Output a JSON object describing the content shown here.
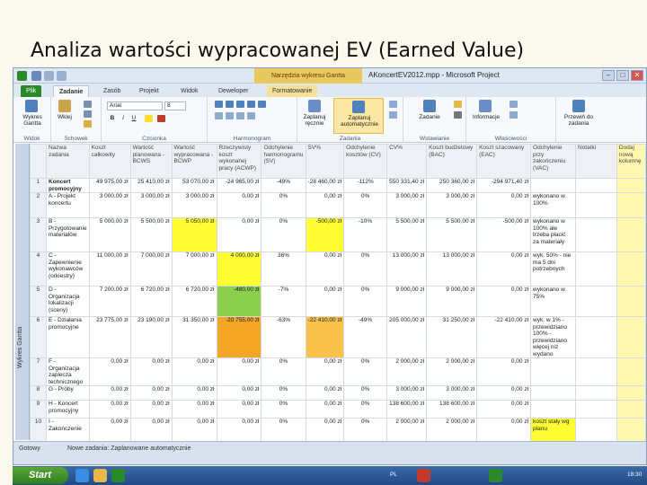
{
  "slide_title": "Analiza wartości wypracowanej EV (Earned Value)",
  "window": {
    "context_tab": "Narzędzia wykresu Gantta",
    "doc_title": "AKoncertEV2012.mpp - Microsoft Project",
    "min": "–",
    "max": "□",
    "close": "✕"
  },
  "tabs": {
    "file": "Plik",
    "task": "Zadanie",
    "resource": "Zasób",
    "project": "Projekt",
    "view": "Widok",
    "developer": "Deweloper",
    "format": "Formatowanie"
  },
  "ribbon": {
    "gantt_chart": "Wykres Gantta",
    "paste": "Wklej",
    "font_name": "Arial",
    "font_size": "8",
    "bold": "B",
    "italic": "I",
    "underline": "U",
    "manual": "Zaplanuj ręcznie",
    "auto": "Zaplanuj automatycznie",
    "task": "Zadanie",
    "info": "Informacje",
    "scroll": "Przewiń do zadania",
    "groups": {
      "view": "Widok",
      "clipboard": "Schowek",
      "font": "Czcionka",
      "schedule": "Harmonogram",
      "tasks": "Zadania",
      "insert": "Wstawianie",
      "properties": "Właściwości"
    }
  },
  "columns": [
    "Nazwa zadania",
    "Koszt całkowity",
    "Wartość planowana - BCWS",
    "Wartość wypracowana - BCWP",
    "Rzeczywisty koszt wykonanej pracy (ACWP)",
    "Odchylenie harmonogramu (SV)",
    "SV%",
    "Odchylenie kosztów (CV)",
    "CV%",
    "Koszt budżetowy (BAC)",
    "Koszt szacowany (EAC)",
    "Odchylenie przy zakończeniu (VAC)",
    "Notatki",
    "Dodaj nową kolumnę"
  ],
  "rows": [
    {
      "id": "1",
      "name": "Koncert promocyjny",
      "cost": "49 975,00 zł",
      "bcws": "25 410,00 zł",
      "bcwp": "53 070,00 zł",
      "acwp": "-24 965,00 zł",
      "sv": "-49%",
      "svp": "-28 460,00 zł",
      "cv": "-112%",
      "cvp": "550 331,40 zł",
      "bac": "250 360,00 zł",
      "eac": "-294 971,40 zł",
      "notes": ""
    },
    {
      "id": "2",
      "name": "A - Projekt koncertu",
      "cost": "3 000,00 zł",
      "bcws": "3 000,00 zł",
      "bcwp": "3 000,00 zł",
      "acwp": "0,00 zł",
      "sv": "0%",
      "svp": "0,00 zł",
      "cv": "0%",
      "cvp": "3 000,00 zł",
      "bac": "3 000,00 zł",
      "eac": "0,00 zł",
      "notes": "wykonano w 100%"
    },
    {
      "id": "3",
      "name": "B - Przygotowanie materiałów",
      "cost": "5 000,00 zł",
      "bcws": "5 500,00 zł",
      "bcwp": "5 050,00 zł",
      "acwp": "0,00 zł",
      "sv": "0%",
      "svp": "-500,00 zł",
      "cv": "-10%",
      "cvp": "5 500,00 zł",
      "bac": "5 500,00 zł",
      "eac": "-500,00 zł",
      "notes": "wykonano w 100% ale trzeba płacić za materiały"
    },
    {
      "id": "4",
      "name": "C - Zapewnienie wykonawców (orkiestry)",
      "cost": "11 000,00 zł",
      "bcws": "7 000,00 zł",
      "bcwp": "7 000,00 zł",
      "acwp": "4 000,00 zł",
      "sv": "36%",
      "svp": "0,00 zł",
      "cv": "0%",
      "cvp": "13 000,00 zł",
      "bac": "13 000,00 zł",
      "eac": "0,00 zł",
      "notes": "wyk. 50% - nie ma 5 dni potrzebnych"
    },
    {
      "id": "5",
      "name": "D - Organizacja lokalizacji (sceny)",
      "cost": "7 200,00 zł",
      "bcws": "6 720,00 zł",
      "bcwp": "6 720,00 zł",
      "acwp": "-480,00 zł",
      "sv": "-7%",
      "svp": "0,00 zł",
      "cv": "0%",
      "cvp": "9 000,00 zł",
      "bac": "9 000,00 zł",
      "eac": "0,00 zł",
      "notes": "wykonano w 75%"
    },
    {
      "id": "6",
      "name": "E - Działania promocyjne",
      "cost": "23 775,00 zł",
      "bcws": "23 190,00 zł",
      "bcwp": "31 350,00 zł",
      "acwp": "-20 755,00 zł",
      "sv": "-63%",
      "svp": "-22 410,00 zł",
      "cv": "-49%",
      "cvp": "205 000,00 zł",
      "bac": "31 250,00 zł",
      "eac": "-22 410,00 zł",
      "notes": "wyk. w 1% - przewidziano 100% - przewidziano więcej niż wydano"
    },
    {
      "id": "7",
      "name": "F - Organizacja zaplecza technicznego",
      "cost": "0,00 zł",
      "bcws": "0,00 zł",
      "bcwp": "0,00 zł",
      "acwp": "0,00 zł",
      "sv": "0%",
      "svp": "0,00 zł",
      "cv": "0%",
      "cvp": "2 000,00 zł",
      "bac": "2 000,00 zł",
      "eac": "0,00 zł",
      "notes": ""
    },
    {
      "id": "8",
      "name": "G - Próby",
      "cost": "0,00 zł",
      "bcws": "0,00 zł",
      "bcwp": "0,00 zł",
      "acwp": "0,00 zł",
      "sv": "0%",
      "svp": "0,00 zł",
      "cv": "0%",
      "cvp": "3 000,00 zł",
      "bac": "3 000,00 zł",
      "eac": "0,00 zł",
      "notes": ""
    },
    {
      "id": "9",
      "name": "H - Koncert promocyjny",
      "cost": "0,00 zł",
      "bcws": "0,00 zł",
      "bcwp": "0,00 zł",
      "acwp": "0,00 zł",
      "sv": "0%",
      "svp": "0,00 zł",
      "cv": "0%",
      "cvp": "138 600,00 zł",
      "bac": "138 600,00 zł",
      "eac": "0,00 zł",
      "notes": ""
    },
    {
      "id": "10",
      "name": "I - Zakończenie",
      "cost": "0,00 zł",
      "bcws": "0,00 zł",
      "bcwp": "0,00 zł",
      "acwp": "0,00 zł",
      "sv": "0%",
      "svp": "0,00 zł",
      "cv": "0%",
      "cvp": "2 000,00 zł",
      "bac": "2 000,00 zł",
      "eac": "0,00 zł",
      "notes": "koszt stały wg planu"
    }
  ],
  "statusbar": {
    "ready": "Gotowy",
    "new_tasks": "Nowe zadania: Zaplanowane automatycznie"
  },
  "sidebar_label": "Wykres Gantta",
  "taskbar": {
    "start": "Start",
    "lang": "PL",
    "clock": "18:30"
  },
  "colors": {
    "yellow": "#ffff33",
    "green": "#8ccf4d",
    "orange": "#f3a526"
  }
}
